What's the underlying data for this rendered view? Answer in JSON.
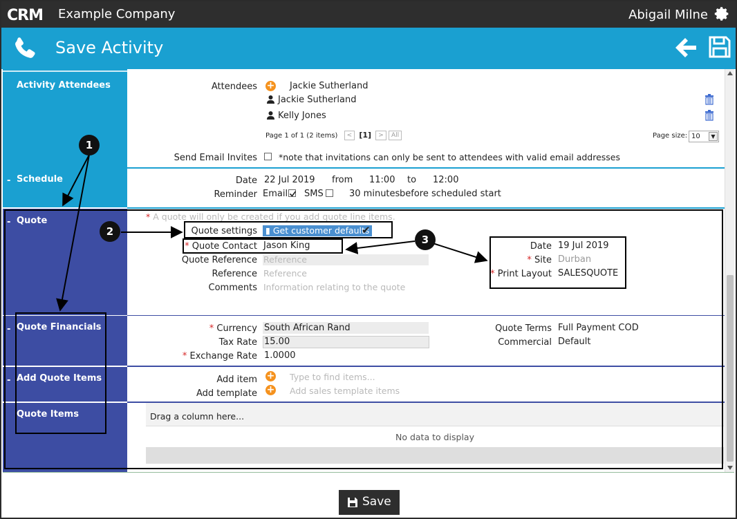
{
  "header": {
    "company": "Example Company",
    "user": "Abigail Milne"
  },
  "title_bar": {
    "title": "Save Activity"
  },
  "attendees": {
    "section_label": "Activity Attendees",
    "field_label": "Attendees",
    "selected": "Jackie Sutherland",
    "list": [
      "Jackie Sutherland",
      "Kelly Jones"
    ],
    "pager_text": "Page 1 of 1 (2 items)",
    "current_page": "[1]",
    "all_label": "All",
    "page_size_label": "Page size:",
    "page_size_value": "10",
    "email_invites_label": "Send Email Invites",
    "email_invites_note": "*note that invitations can only be sent to attendees with valid email addresses"
  },
  "schedule": {
    "section_label": "Schedule",
    "date_label": "Date",
    "date_value": "22 Jul 2019",
    "from_label": "from",
    "from_time": "11:00",
    "to_label": "to",
    "to_time": "12:00",
    "reminder_label": "Reminder",
    "email_label": "Email",
    "sms_label": "SMS",
    "minutes_text": "30 minutes",
    "before_text": "before scheduled start"
  },
  "quote": {
    "section_label": "Quote",
    "note": "A quote will only be created if you add quote line items.",
    "settings_label": "Quote settings",
    "settings_button": "Get customer defaults",
    "contact_label": "Quote Contact",
    "contact_value": "Jason King",
    "reference_label": "Quote Reference",
    "reference_placeholder": "Reference",
    "ref_label": "Reference",
    "ref_placeholder": "Reference",
    "comments_label": "Comments",
    "comments_placeholder": "Information relating to the quote",
    "date_label": "Date",
    "date_value": "19 Jul 2019",
    "site_label": "Site",
    "site_value": "Durban",
    "layout_label": "Print Layout",
    "layout_value": "SALESQUOTE"
  },
  "financials": {
    "section_label": "Quote Financials",
    "currency_label": "Currency",
    "currency_value": "South African Rand",
    "tax_label": "Tax Rate",
    "tax_value": "15.00",
    "exchange_label": "Exchange Rate",
    "exchange_value": "1.0000",
    "terms_label": "Quote Terms",
    "terms_value": "Full Payment COD",
    "commercial_label": "Commercial",
    "commercial_value": "Default"
  },
  "add_items": {
    "section_label": "Add Quote Items",
    "item_label": "Add item",
    "item_placeholder": "Type to find items...",
    "template_label": "Add template",
    "template_placeholder": "Add sales template items"
  },
  "quote_items": {
    "section_label": "Quote Items",
    "drag_text": "Drag a column here...",
    "empty_text": "No data to display"
  },
  "annotations": [
    "1",
    "2",
    "3"
  ],
  "footer": {
    "save_label": "Save"
  },
  "colors": {
    "teal": "#1aa0d1",
    "navy": "#3d4da3",
    "dark": "#2e2e2e",
    "orange": "#f5921e"
  }
}
